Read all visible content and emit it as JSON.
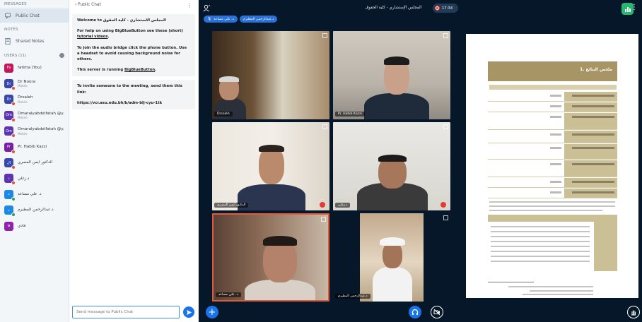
{
  "sidebar": {
    "messages_title": "MESSAGES",
    "public_chat": "Public Chat",
    "notes_title": "NOTES",
    "shared_notes": "Shared Notes",
    "users_title": "USERS (11)",
    "users": [
      {
        "initials": "Fa",
        "name": "fatima (You)",
        "role": "",
        "color": "#c2185b",
        "mic": "none"
      },
      {
        "initials": "Dr",
        "name": "Dr Noora",
        "role": "Mobile",
        "color": "#3949ab",
        "mic": "muted"
      },
      {
        "initials": "Dr",
        "name": "Drsaleh",
        "role": "Mobile",
        "color": "#3949ab",
        "mic": "muted"
      },
      {
        "initials": "Om",
        "name": "Omaralyabdelfatah @y...",
        "role": "Mobile",
        "color": "#5e35b1",
        "mic": "muted"
      },
      {
        "initials": "Om",
        "name": "Omaralyabdelfatah @y...",
        "role": "Mobile",
        "color": "#5e35b1",
        "mic": "muted"
      },
      {
        "initials": "Pr",
        "name": "Pr. Habib Kazzi",
        "role": "",
        "color": "#7b1fa2",
        "mic": "muted"
      },
      {
        "initials": "ال",
        "name": "الدكتور ايمن المصري",
        "role": "",
        "color": "#3949ab",
        "mic": "muted"
      },
      {
        "initials": "د",
        "name": "د.زغلي",
        "role": "",
        "color": "#5e35b1",
        "mic": "muted"
      },
      {
        "initials": "د",
        "name": "د. علي مساعد",
        "role": "",
        "color": "#1e88e5",
        "mic": "ok"
      },
      {
        "initials": "د",
        "name": "د.عبدالرحمن المطيرم",
        "role": "",
        "color": "#1e88e5",
        "mic": "ok"
      },
      {
        "initials": "فا",
        "name": "فادي",
        "role": "",
        "color": "#8e24aa",
        "mic": "none"
      }
    ]
  },
  "chat": {
    "back_label": "‹  Public Chat",
    "welcome": "Welcome to",
    "welcome_arabic": "المجلس الاستشاري - كلية الحقوق",
    "help_prefix": "For help on using BigBlueButton see these (short) ",
    "help_link": "tutorial videos",
    "audio_text": "To join the audio bridge click the phone button. Use a headset to avoid causing background noise for others.",
    "running_prefix": "This server is running ",
    "running_link": "BigBlueButton",
    "invite_text": "To invite someone to the meeting, send them this link:",
    "invite_link": "https://vcr.asu.edu.bh/b/adm-blj-cyu-1tk",
    "input_placeholder": "Send message to Public Chat"
  },
  "meeting": {
    "title": "المجلس الإستشاري - كلية الحقوق",
    "recording_time": "17:34",
    "talking_pills": [
      "د. علي مساعد",
      "د.عبدالرحمن المطيرم"
    ],
    "tiles": [
      {
        "label": "Drsaleh"
      },
      {
        "label": "Pr. Habib Kazzi"
      },
      {
        "label": "الدكتور ايمن المصري"
      },
      {
        "label": "د.زغلي"
      },
      {
        "label": "د. علي مساعد"
      },
      {
        "label": "د.عبدالرحمن المطيرم"
      }
    ],
    "slide_title": "1. ملخص النتائج"
  }
}
